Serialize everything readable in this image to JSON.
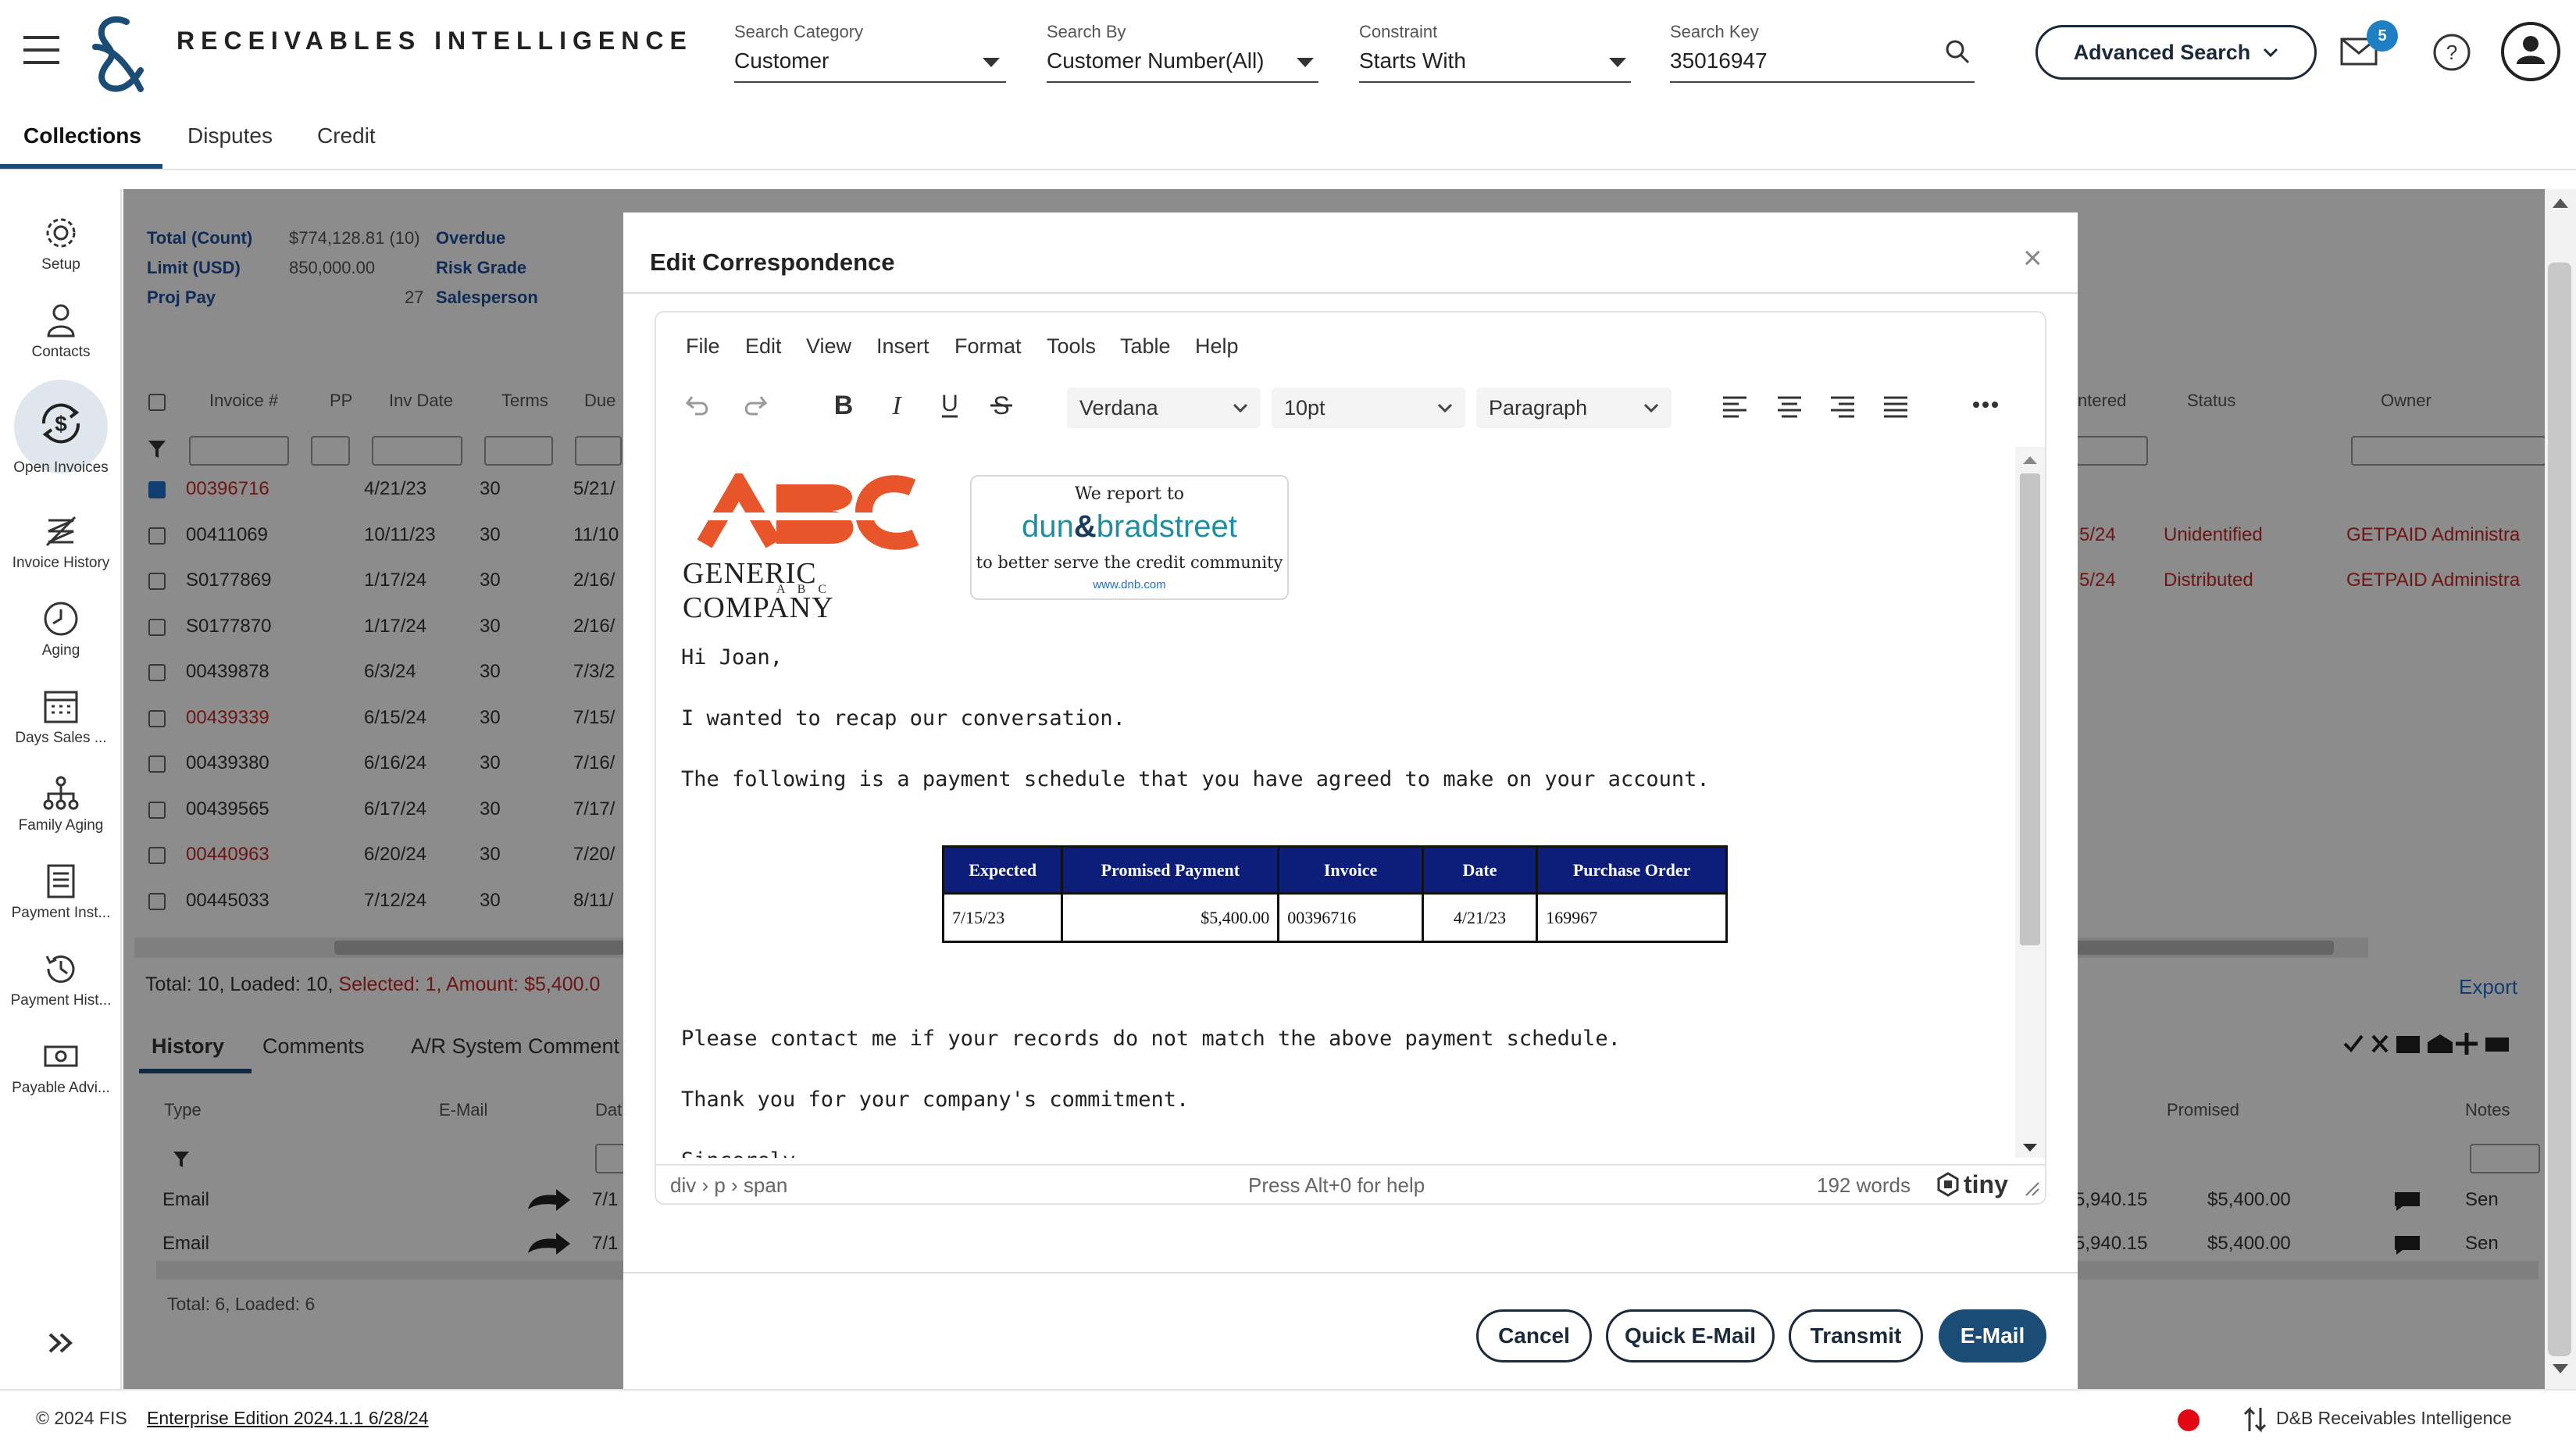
{
  "app": {
    "title": "RECEIVABLES INTELLIGENCE"
  },
  "search": {
    "category_label": "Search Category",
    "category_value": "Customer",
    "by_label": "Search By",
    "by_value": "Customer Number(All)",
    "constraint_label": "Constraint",
    "constraint_value": "Starts With",
    "key_label": "Search Key",
    "key_value": "35016947",
    "advanced_label": "Advanced Search"
  },
  "header": {
    "mail_count": "5"
  },
  "tabs": [
    {
      "label": "Collections",
      "active": true
    },
    {
      "label": "Disputes"
    },
    {
      "label": "Credit"
    }
  ],
  "nav": [
    {
      "label": "Setup",
      "icon": "gear-icon"
    },
    {
      "label": "Contacts",
      "icon": "person-icon"
    },
    {
      "label": "Open Invoices",
      "icon": "dollar-cycle-icon",
      "active": true
    },
    {
      "label": "Invoice History",
      "icon": "invoice-history-icon"
    },
    {
      "label": "Aging",
      "icon": "clock-icon"
    },
    {
      "label": "Days Sales ...",
      "icon": "calendar-icon"
    },
    {
      "label": "Family Aging",
      "icon": "hierarchy-icon"
    },
    {
      "label": "Payment Inst...",
      "icon": "document-icon"
    },
    {
      "label": "Payment Hist...",
      "icon": "history-icon"
    },
    {
      "label": "Payable Advi...",
      "icon": "money-icon"
    }
  ],
  "summary": {
    "total_label": "Total (Count)",
    "total_value": "$774,128.81 (10)",
    "limit_label": "Limit (USD)",
    "limit_value": "850,000.00",
    "projpay_label": "Proj Pay",
    "projpay_value": "27",
    "overdue_label": "Overdue",
    "risk_label": "Risk Grade",
    "sales_label": "Salesperson"
  },
  "invoice_table": {
    "headers": [
      "Invoice #",
      "PP",
      "Inv Date",
      "Terms",
      "Due"
    ],
    "right_headers": [
      "ntered",
      "Status",
      "Owner"
    ],
    "rows": [
      {
        "invoice": "00396716",
        "date": "4/21/23",
        "terms": "30",
        "due": "5/21/",
        "checked": true,
        "red": true
      },
      {
        "invoice": "00411069",
        "date": "10/11/23",
        "terms": "30",
        "due": "11/10",
        "status": "Unidentified",
        "owner": "GETPAID Administra",
        "entered": "5/24"
      },
      {
        "invoice": "S0177869",
        "date": "1/17/24",
        "terms": "30",
        "due": "2/16/",
        "status": "Distributed",
        "owner": "GETPAID Administra",
        "entered": "5/24"
      },
      {
        "invoice": "S0177870",
        "date": "1/17/24",
        "terms": "30",
        "due": "2/16/"
      },
      {
        "invoice": "00439878",
        "date": "6/3/24",
        "terms": "30",
        "due": "7/3/2"
      },
      {
        "invoice": "00439339",
        "date": "6/15/24",
        "terms": "30",
        "due": "7/15/",
        "red": true
      },
      {
        "invoice": "00439380",
        "date": "6/16/24",
        "terms": "30",
        "due": "7/16/"
      },
      {
        "invoice": "00439565",
        "date": "6/17/24",
        "terms": "30",
        "due": "7/17/"
      },
      {
        "invoice": "00440963",
        "date": "6/20/24",
        "terms": "30",
        "due": "7/20/",
        "red": true
      },
      {
        "invoice": "00445033",
        "date": "7/12/24",
        "terms": "30",
        "due": "8/11/"
      }
    ],
    "totals_prefix": "Total: 10, Loaded: 10, ",
    "totals_selected": "Selected: 1, Amount: $5,400.0",
    "export_label": "Export"
  },
  "history": {
    "tabs": [
      "History",
      "Comments",
      "A/R System Comment"
    ],
    "headers": [
      "Type",
      "E-Mail",
      "Dat"
    ],
    "right_headers": [
      "Promised",
      "Notes"
    ],
    "rows": [
      {
        "type": "Email",
        "date": "7/1",
        "amount1": "5,940.15",
        "amount2": "$5,400.00",
        "note": "Sen"
      },
      {
        "type": "Email",
        "date": "7/1",
        "amount1": "5,940.15",
        "amount2": "$5,400.00",
        "note": "Sen"
      }
    ],
    "totals": "Total: 6, Loaded: 6"
  },
  "modal": {
    "title": "Edit Correspondence",
    "close": "×",
    "menu": [
      "File",
      "Edit",
      "View",
      "Insert",
      "Format",
      "Tools",
      "Table",
      "Help"
    ],
    "font_family": "Verdana",
    "font_size": "10pt",
    "block_format": "Paragraph",
    "logo": {
      "company": "GENERIC COMPANY",
      "sub": "A B C"
    },
    "dnb": {
      "line1": "We report to",
      "brand_left": "dun",
      "brand_right": "bradstreet",
      "line2": "to better serve the credit community",
      "url": "www.dnb.com"
    },
    "greeting": "Hi Joan,",
    "p1": "I wanted to recap our conversation.",
    "p2": "The following is a payment schedule that you have agreed to make on your account.",
    "schedule": {
      "headers": [
        "Expected",
        "Promised Payment",
        "Invoice",
        "Date",
        "Purchase Order"
      ],
      "row": [
        "7/15/23",
        "$5,400.00",
        "00396716",
        "4/21/23",
        "169967"
      ]
    },
    "p3": "Please contact me if your records do not match the above payment schedule.",
    "p4": "Thank you for your company's commitment.",
    "p5": "Sincerely",
    "status_path": "div › p › span",
    "status_help": "Press Alt+0 for help",
    "status_words": "192 words",
    "tiny": "tiny",
    "buttons": {
      "cancel": "Cancel",
      "quick_email": "Quick E-Mail",
      "transmit": "Transmit",
      "email": "E-Mail"
    }
  },
  "footer": {
    "copyright": "© 2024 FIS",
    "edition": "Enterprise Edition 2024.1.1 6/28/24",
    "product": "D&B Receivables Intelligence"
  },
  "colors": {
    "brand_navy": "#1a4c76",
    "dnb_teal": "#1f8ea3",
    "abc_orange": "#e8552b",
    "record_red": "#e30613"
  }
}
